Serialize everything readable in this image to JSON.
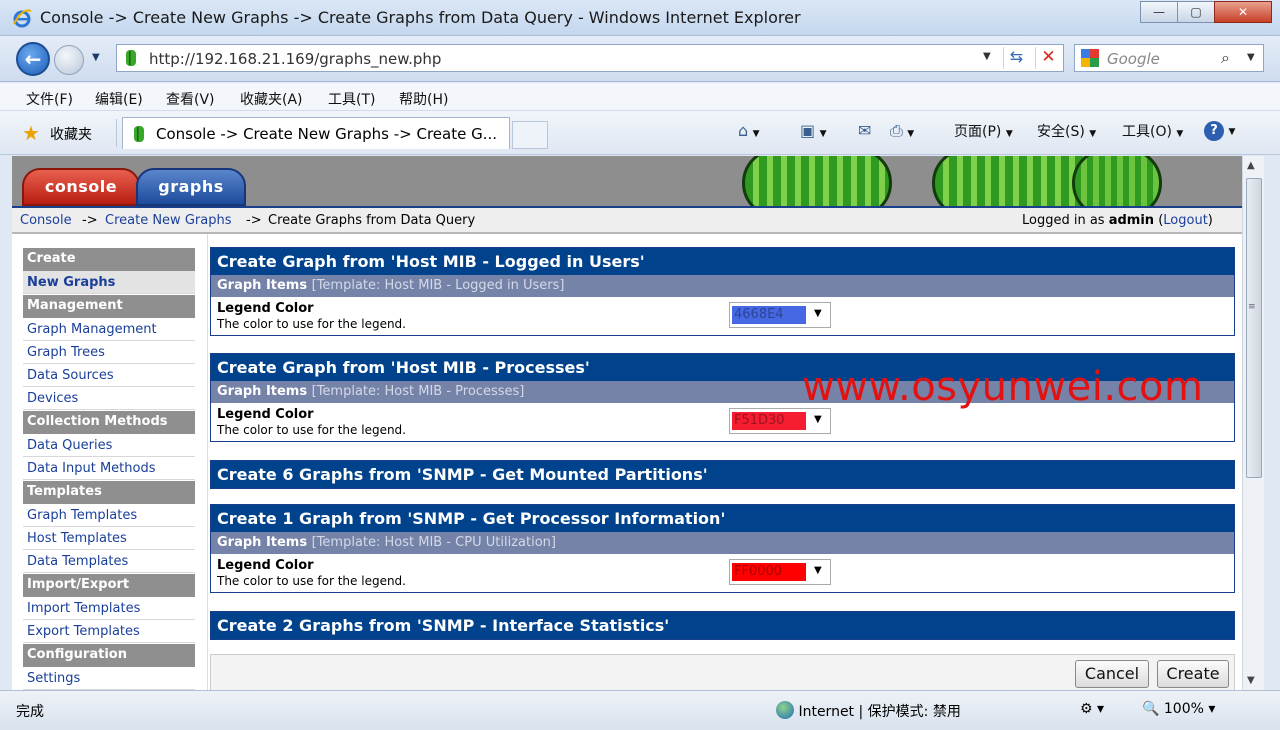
{
  "window": {
    "title": "Console -> Create New Graphs -> Create Graphs from Data Query - Windows Internet Explorer",
    "buttons": {
      "minimize": "—",
      "maximize": "▢",
      "close": "✕"
    }
  },
  "nav": {
    "url": "http://192.168.21.169/graphs_new.php",
    "search_placeholder": "Google"
  },
  "menu": [
    "文件(F)",
    "编辑(E)",
    "查看(V)",
    "收藏夹(A)",
    "工具(T)",
    "帮助(H)"
  ],
  "favbar": {
    "favorites_label": "收藏夹",
    "tab_title": "Console -> Create New Graphs -> Create G...",
    "commands": {
      "page": "页面(P)",
      "safety": "安全(S)",
      "tools": "工具(O)"
    }
  },
  "cacti": {
    "tabs": {
      "console": "console",
      "graphs": "graphs"
    },
    "breadcrumb": {
      "console": "Console",
      "sep1": "->",
      "new_graphs": "Create New Graphs",
      "sep2": "->",
      "current": "Create Graphs from Data Query"
    },
    "login": {
      "prefix": "Logged in as",
      "user": "admin",
      "logout_open": "(",
      "logout": "Logout",
      "logout_close": ")"
    }
  },
  "sidebar": {
    "create_header": "Create",
    "new_graphs": "New Graphs",
    "management_header": "Management",
    "graph_management": "Graph Management",
    "graph_trees": "Graph Trees",
    "data_sources": "Data Sources",
    "devices": "Devices",
    "collection_header": "Collection Methods",
    "data_queries": "Data Queries",
    "data_input_methods": "Data Input Methods",
    "templates_header": "Templates",
    "graph_templates": "Graph Templates",
    "host_templates": "Host Templates",
    "data_templates": "Data Templates",
    "import_export_header": "Import/Export",
    "import_templates": "Import Templates",
    "export_templates": "Export Templates",
    "configuration_header": "Configuration",
    "settings": "Settings"
  },
  "sections": {
    "users": {
      "title": "Create Graph from 'Host MIB - Logged in Users'",
      "items_label": "Graph Items",
      "template": "[Template: Host MIB - Logged in Users]",
      "field": "Legend Color",
      "desc": "The color to use for the legend.",
      "color_value": "4668E4",
      "color_hex": "#4668E4"
    },
    "processes": {
      "title": "Create Graph from 'Host MIB - Processes'",
      "items_label": "Graph Items",
      "template": "[Template: Host MIB - Processes]",
      "field": "Legend Color",
      "desc": "The color to use for the legend.",
      "color_value": "F51D30",
      "color_hex": "#F51D30"
    },
    "partitions": {
      "title": "Create 6 Graphs from 'SNMP - Get Mounted Partitions'"
    },
    "processor": {
      "title": "Create 1 Graph from 'SNMP - Get Processor Information'",
      "items_label": "Graph Items",
      "template": "[Template: Host MIB - CPU Utilization]",
      "field": "Legend Color",
      "desc": "The color to use for the legend.",
      "color_value": "FF0000",
      "color_hex": "#FF0000"
    },
    "interfaces": {
      "title": "Create 2 Graphs from 'SNMP - Interface Statistics'"
    }
  },
  "watermark": "www.osyunwei.com",
  "actions": {
    "cancel": "Cancel",
    "create": "Create"
  },
  "status": {
    "done": "完成",
    "zone": "Internet | 保护模式: 禁用",
    "zoom": "100%"
  },
  "colors": {
    "cacti_header_blue": "#00438C",
    "sub_header": "#7683A8",
    "sidebar_header": "#8F8F8F"
  }
}
